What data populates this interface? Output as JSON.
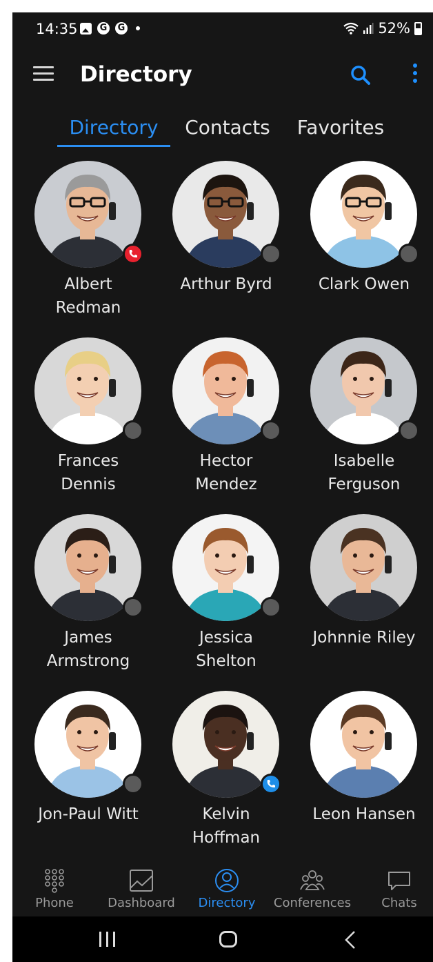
{
  "status_bar": {
    "time": "14:35",
    "battery": "52%",
    "icons": [
      "gallery-icon",
      "g-icon",
      "g-icon",
      "dot-icon",
      "wifi-icon",
      "signal-icon",
      "battery-icon"
    ]
  },
  "app_bar": {
    "title": "Directory",
    "menu_icon": "hamburger-icon",
    "search_icon": "search-icon",
    "more_icon": "more-vert-icon"
  },
  "tabs": [
    {
      "label": "Directory",
      "active": true
    },
    {
      "label": "Contacts",
      "active": false
    },
    {
      "label": "Favorites",
      "active": false
    }
  ],
  "contacts": [
    {
      "name": "Albert Redman",
      "line1": "Albert",
      "line2": "Redman",
      "status": "busy",
      "skin": "#e7b896",
      "hair": "#9a9a9a",
      "bg": "#c9ccd1",
      "shirt": "#2c2f36",
      "glasses": true
    },
    {
      "name": "Arthur Byrd",
      "line1": "Arthur Byrd",
      "line2": "",
      "status": "offline",
      "skin": "#8a5a3c",
      "hair": "#1c140f",
      "bg": "#e9e9e9",
      "shirt": "#2a3c5e",
      "glasses": true
    },
    {
      "name": "Clark Owen",
      "line1": "Clark Owen",
      "line2": "",
      "status": "offline",
      "skin": "#f0c6a3",
      "hair": "#3b2a1c",
      "bg": "#ffffff",
      "shirt": "#8ec3e6",
      "glasses": true
    },
    {
      "name": "Frances Dennis",
      "line1": "Frances",
      "line2": "Dennis",
      "status": "offline",
      "skin": "#f3cfb2",
      "hair": "#e8cf86",
      "bg": "#d8d8d8",
      "shirt": "#ffffff",
      "glasses": false
    },
    {
      "name": "Hector Mendez",
      "line1": "Hector",
      "line2": "Mendez",
      "status": "offline",
      "skin": "#f0b99a",
      "hair": "#c8642e",
      "bg": "#f2f2f2",
      "shirt": "#6d8fb8",
      "glasses": false
    },
    {
      "name": "Isabelle Ferguson",
      "line1": "Isabelle",
      "line2": "Ferguson",
      "status": "offline",
      "skin": "#f1c8ad",
      "hair": "#3c2618",
      "bg": "#c5c8cc",
      "shirt": "#ffffff",
      "glasses": false
    },
    {
      "name": "James Armstrong",
      "line1": "James",
      "line2": "Armstrong",
      "status": "offline",
      "skin": "#e6b08e",
      "hair": "#2b1e17",
      "bg": "#d8d8d8",
      "shirt": "#2c2f36",
      "glasses": false
    },
    {
      "name": "Jessica Shelton",
      "line1": "Jessica",
      "line2": "Shelton",
      "status": "offline",
      "skin": "#f3cdb2",
      "hair": "#9a5a2e",
      "bg": "#f4f4f4",
      "shirt": "#2aa7b6",
      "glasses": false
    },
    {
      "name": "Johnnie Riley",
      "line1": "Johnnie Riley",
      "line2": "",
      "status": "none",
      "skin": "#e9b897",
      "hair": "#4a3222",
      "bg": "#cfcfcf",
      "shirt": "#2c2f36",
      "glasses": false
    },
    {
      "name": "Jon-Paul Witt",
      "line1": "Jon-Paul Witt",
      "line2": "",
      "status": "offline",
      "skin": "#f0c4a4",
      "hair": "#3a2a1e",
      "bg": "#ffffff",
      "shirt": "#9bc3e6",
      "glasses": false
    },
    {
      "name": "Kelvin Hoffman",
      "line1": "Kelvin",
      "line2": "Hoffman",
      "status": "oncall",
      "skin": "#4a2f22",
      "hair": "#1b1310",
      "bg": "#f0eee8",
      "shirt": "#2c2f36",
      "glasses": false
    },
    {
      "name": "Leon Hansen",
      "line1": "Leon Hansen",
      "line2": "",
      "status": "none",
      "skin": "#f1c4a3",
      "hair": "#5b3a24",
      "bg": "#ffffff",
      "shirt": "#5b7fb0",
      "glasses": false
    }
  ],
  "bottom_nav": [
    {
      "label": "Phone",
      "icon": "dialpad-icon",
      "active": false
    },
    {
      "label": "Dashboard",
      "icon": "dashboard-icon",
      "active": false
    },
    {
      "label": "Directory",
      "icon": "directory-icon",
      "active": true
    },
    {
      "label": "Conferences",
      "icon": "conferences-icon",
      "active": false
    },
    {
      "label": "Chats",
      "icon": "chat-icon",
      "active": false
    }
  ],
  "colors": {
    "accent": "#2b8ef2",
    "background": "#161616",
    "busy": "#e8212e",
    "oncall": "#1e8ee8",
    "offline": "#5a5a5a"
  }
}
